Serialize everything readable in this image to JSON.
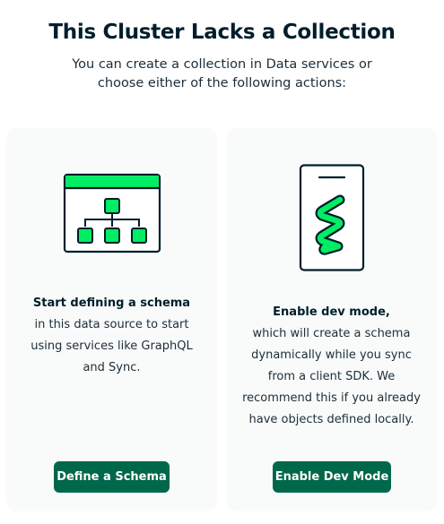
{
  "header": {
    "title": "This Cluster Lacks a Collection",
    "subtitle": "You can create a collection in Data services or choose either of the following actions:"
  },
  "cards": [
    {
      "icon": "schema-diagram-icon",
      "heading": "Start defining a schema",
      "body": "in this data source to start using services like GraphQL and Sync.",
      "button_label": "Define a Schema"
    },
    {
      "icon": "mobile-device-sync-icon",
      "heading": "Enable dev mode,",
      "body": "which will create a schema dynamically while you sync from a client SDK. We recommend this if you already have objects defined locally.",
      "button_label": "Enable Dev Mode"
    }
  ],
  "colors": {
    "accent_green": "#00ed64",
    "button_green": "#00684a",
    "ink": "#001e2b",
    "card_bg": "#f9fbfa"
  }
}
